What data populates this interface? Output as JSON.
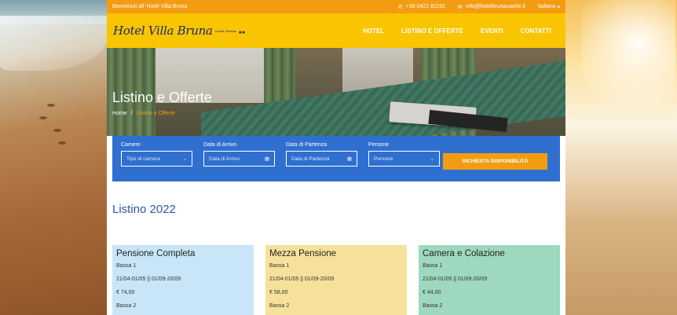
{
  "topbar": {
    "welcome": "Benvenuti all' Hotel Villa Bruna",
    "phone_icon": "phone-icon",
    "phone": "+39 0421 81192",
    "email_icon": "envelope-icon",
    "email": "info@hotelbrunacaorle.it",
    "language": "Italiano",
    "language_caret": "▾"
  },
  "logo": {
    "script": "Hotel Villa Bruna",
    "sub": "Caorle Venezia",
    "stars": "✱✱"
  },
  "nav": {
    "items": [
      "HOTEL",
      "LISTINO E OFFERTE",
      "EVENTI",
      "CONTATTI"
    ]
  },
  "hero": {
    "title": "Listino e Offerte",
    "breadcrumb_home": "Home",
    "breadcrumb_sep": "/",
    "breadcrumb_current": "Listino e Offerte"
  },
  "search": {
    "rooms_label": "Camere",
    "rooms_value": "Tipo di camera",
    "arrival_label": "Data di Arrivo",
    "arrival_placeholder": "Data di Arrivo",
    "departure_label": "Data di Partenza",
    "departure_placeholder": "Data di Partenza",
    "persons_label": "Persone",
    "persons_value": "Persone",
    "button": "RICHIESTA DISPONIBILITÀ"
  },
  "listino": {
    "heading": "Listino 2022",
    "cards": [
      {
        "title": "Pensione Completa",
        "season": "Bassa 1",
        "dates": "21/04-01/05 || 01/09-20/09",
        "price": "€ 74,00",
        "next": "Bassa 2"
      },
      {
        "title": "Mezza Pensione",
        "season": "Bassa 1",
        "dates": "21/04-01/05 || 01/09-20/09",
        "price": "€ 58,00",
        "next": "Bassa 2"
      },
      {
        "title": "Camera e Colazione",
        "season": "Bassa 1",
        "dates": "21/04-01/05 || 01/09-20/09",
        "price": "€ 44,00",
        "next": "Bassa 2"
      }
    ]
  },
  "colors": {
    "topbar": "#f39c12",
    "navbar": "#f9c400",
    "search_panel": "#2f6fd0",
    "accent_button": "#f39c12",
    "heading_blue": "#2e56a6",
    "card_blue": "#c8e6f7",
    "card_yellow": "#f7e19a",
    "card_green": "#9ed9bf"
  }
}
